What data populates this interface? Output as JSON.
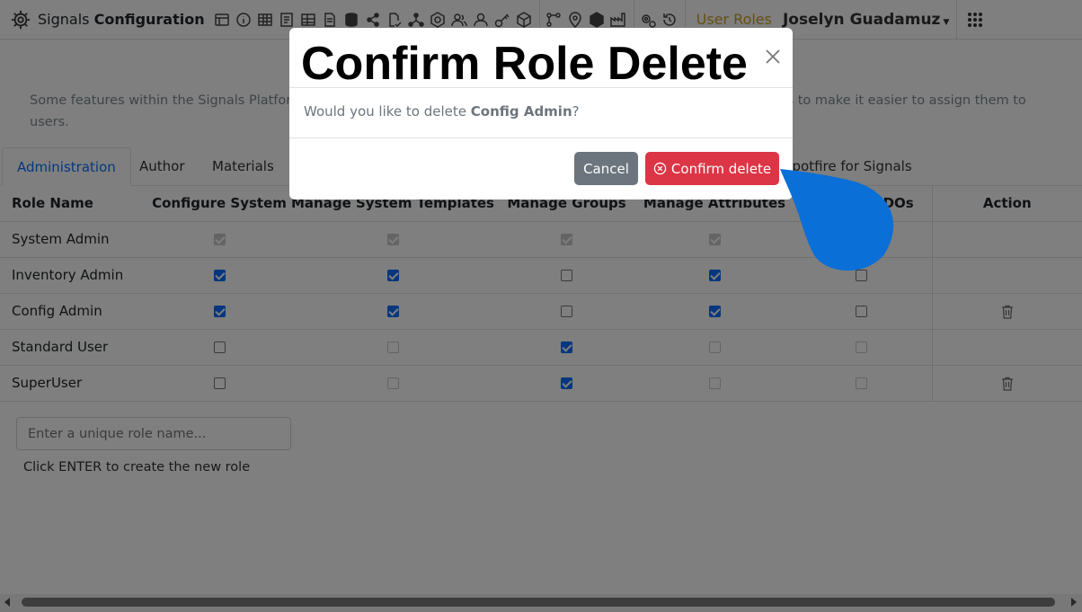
{
  "topbar": {
    "title_light": "Signals",
    "title_bold": "Configuration",
    "icons": [
      "table-icon",
      "info-icon",
      "grid-icon",
      "document-icon",
      "spreadsheet-icon",
      "file-icon",
      "database-icon",
      "share-icon",
      "file-check-icon",
      "network-icon",
      "hexagon-icon",
      "users-icon",
      "user-icon",
      "key-icon",
      "cube-icon",
      "flow-icon",
      "map-pin-icon",
      "plugin-icon",
      "factory-icon",
      "gears-icon",
      "history-icon"
    ],
    "section_label": "User Roles",
    "user_name": "Joselyn Guadamuz",
    "accent_color": "#c9a227"
  },
  "page": {
    "description": "Some features within the Signals Platform are restricted to users with specific permissions. Roles bundle permissions to make it easier to assign them to users.",
    "tabs": [
      {
        "label": "Administration",
        "active": true
      },
      {
        "label": "Author",
        "active": false
      },
      {
        "label": "Materials",
        "active": false
      },
      {
        "label": "Spotfire for Signals",
        "active": false
      }
    ],
    "table": {
      "headers": [
        "Role Name",
        "Configure System",
        "Manage System Templates",
        "Manage Groups",
        "Manage Attributes",
        "Manage SDOs",
        "Action"
      ],
      "rows": [
        {
          "name": "System Admin",
          "checks": [
            "disabled-on",
            "disabled-on",
            "disabled-on",
            "disabled-on"
          ],
          "sdo": "none",
          "deletable": false
        },
        {
          "name": "Inventory Admin",
          "checks": [
            "on",
            "on",
            "off",
            "on"
          ],
          "sdo": "off",
          "deletable": false
        },
        {
          "name": "Config Admin",
          "checks": [
            "on",
            "on",
            "off",
            "on"
          ],
          "sdo": "off",
          "deletable": true
        },
        {
          "name": "Standard User",
          "checks": [
            "off",
            "disabled-off",
            "on",
            "disabled-off"
          ],
          "sdo": "disabled-off",
          "deletable": false
        },
        {
          "name": "SuperUser",
          "checks": [
            "off",
            "disabled-off",
            "on",
            "disabled-off"
          ],
          "sdo": "disabled-off",
          "deletable": true
        }
      ]
    },
    "new_role_placeholder": "Enter a unique role name...",
    "new_role_hint": "Click ENTER to create the new role"
  },
  "modal": {
    "title": "Confirm Role Delete",
    "body_prefix": "Would you like to delete ",
    "body_role": "Config Admin",
    "body_suffix": "?",
    "cancel_label": "Cancel",
    "confirm_label": "Confirm delete",
    "confirm_color": "#dc3545",
    "cancel_color": "#6c757d"
  },
  "pointer_color": "#0a6fd6"
}
